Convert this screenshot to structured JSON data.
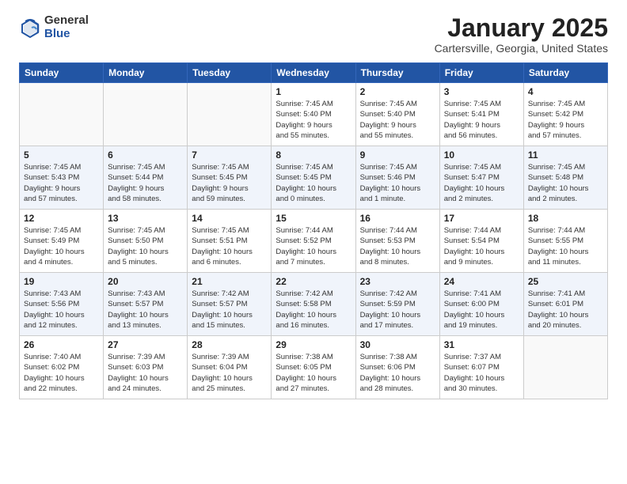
{
  "header": {
    "logo_general": "General",
    "logo_blue": "Blue",
    "month_title": "January 2025",
    "location": "Cartersville, Georgia, United States"
  },
  "weekdays": [
    "Sunday",
    "Monday",
    "Tuesday",
    "Wednesday",
    "Thursday",
    "Friday",
    "Saturday"
  ],
  "weeks": [
    [
      {
        "day": "",
        "info": ""
      },
      {
        "day": "",
        "info": ""
      },
      {
        "day": "",
        "info": ""
      },
      {
        "day": "1",
        "info": "Sunrise: 7:45 AM\nSunset: 5:40 PM\nDaylight: 9 hours\nand 55 minutes."
      },
      {
        "day": "2",
        "info": "Sunrise: 7:45 AM\nSunset: 5:40 PM\nDaylight: 9 hours\nand 55 minutes."
      },
      {
        "day": "3",
        "info": "Sunrise: 7:45 AM\nSunset: 5:41 PM\nDaylight: 9 hours\nand 56 minutes."
      },
      {
        "day": "4",
        "info": "Sunrise: 7:45 AM\nSunset: 5:42 PM\nDaylight: 9 hours\nand 57 minutes."
      }
    ],
    [
      {
        "day": "5",
        "info": "Sunrise: 7:45 AM\nSunset: 5:43 PM\nDaylight: 9 hours\nand 57 minutes."
      },
      {
        "day": "6",
        "info": "Sunrise: 7:45 AM\nSunset: 5:44 PM\nDaylight: 9 hours\nand 58 minutes."
      },
      {
        "day": "7",
        "info": "Sunrise: 7:45 AM\nSunset: 5:45 PM\nDaylight: 9 hours\nand 59 minutes."
      },
      {
        "day": "8",
        "info": "Sunrise: 7:45 AM\nSunset: 5:45 PM\nDaylight: 10 hours\nand 0 minutes."
      },
      {
        "day": "9",
        "info": "Sunrise: 7:45 AM\nSunset: 5:46 PM\nDaylight: 10 hours\nand 1 minute."
      },
      {
        "day": "10",
        "info": "Sunrise: 7:45 AM\nSunset: 5:47 PM\nDaylight: 10 hours\nand 2 minutes."
      },
      {
        "day": "11",
        "info": "Sunrise: 7:45 AM\nSunset: 5:48 PM\nDaylight: 10 hours\nand 2 minutes."
      }
    ],
    [
      {
        "day": "12",
        "info": "Sunrise: 7:45 AM\nSunset: 5:49 PM\nDaylight: 10 hours\nand 4 minutes."
      },
      {
        "day": "13",
        "info": "Sunrise: 7:45 AM\nSunset: 5:50 PM\nDaylight: 10 hours\nand 5 minutes."
      },
      {
        "day": "14",
        "info": "Sunrise: 7:45 AM\nSunset: 5:51 PM\nDaylight: 10 hours\nand 6 minutes."
      },
      {
        "day": "15",
        "info": "Sunrise: 7:44 AM\nSunset: 5:52 PM\nDaylight: 10 hours\nand 7 minutes."
      },
      {
        "day": "16",
        "info": "Sunrise: 7:44 AM\nSunset: 5:53 PM\nDaylight: 10 hours\nand 8 minutes."
      },
      {
        "day": "17",
        "info": "Sunrise: 7:44 AM\nSunset: 5:54 PM\nDaylight: 10 hours\nand 9 minutes."
      },
      {
        "day": "18",
        "info": "Sunrise: 7:44 AM\nSunset: 5:55 PM\nDaylight: 10 hours\nand 11 minutes."
      }
    ],
    [
      {
        "day": "19",
        "info": "Sunrise: 7:43 AM\nSunset: 5:56 PM\nDaylight: 10 hours\nand 12 minutes."
      },
      {
        "day": "20",
        "info": "Sunrise: 7:43 AM\nSunset: 5:57 PM\nDaylight: 10 hours\nand 13 minutes."
      },
      {
        "day": "21",
        "info": "Sunrise: 7:42 AM\nSunset: 5:57 PM\nDaylight: 10 hours\nand 15 minutes."
      },
      {
        "day": "22",
        "info": "Sunrise: 7:42 AM\nSunset: 5:58 PM\nDaylight: 10 hours\nand 16 minutes."
      },
      {
        "day": "23",
        "info": "Sunrise: 7:42 AM\nSunset: 5:59 PM\nDaylight: 10 hours\nand 17 minutes."
      },
      {
        "day": "24",
        "info": "Sunrise: 7:41 AM\nSunset: 6:00 PM\nDaylight: 10 hours\nand 19 minutes."
      },
      {
        "day": "25",
        "info": "Sunrise: 7:41 AM\nSunset: 6:01 PM\nDaylight: 10 hours\nand 20 minutes."
      }
    ],
    [
      {
        "day": "26",
        "info": "Sunrise: 7:40 AM\nSunset: 6:02 PM\nDaylight: 10 hours\nand 22 minutes."
      },
      {
        "day": "27",
        "info": "Sunrise: 7:39 AM\nSunset: 6:03 PM\nDaylight: 10 hours\nand 24 minutes."
      },
      {
        "day": "28",
        "info": "Sunrise: 7:39 AM\nSunset: 6:04 PM\nDaylight: 10 hours\nand 25 minutes."
      },
      {
        "day": "29",
        "info": "Sunrise: 7:38 AM\nSunset: 6:05 PM\nDaylight: 10 hours\nand 27 minutes."
      },
      {
        "day": "30",
        "info": "Sunrise: 7:38 AM\nSunset: 6:06 PM\nDaylight: 10 hours\nand 28 minutes."
      },
      {
        "day": "31",
        "info": "Sunrise: 7:37 AM\nSunset: 6:07 PM\nDaylight: 10 hours\nand 30 minutes."
      },
      {
        "day": "",
        "info": ""
      }
    ]
  ]
}
